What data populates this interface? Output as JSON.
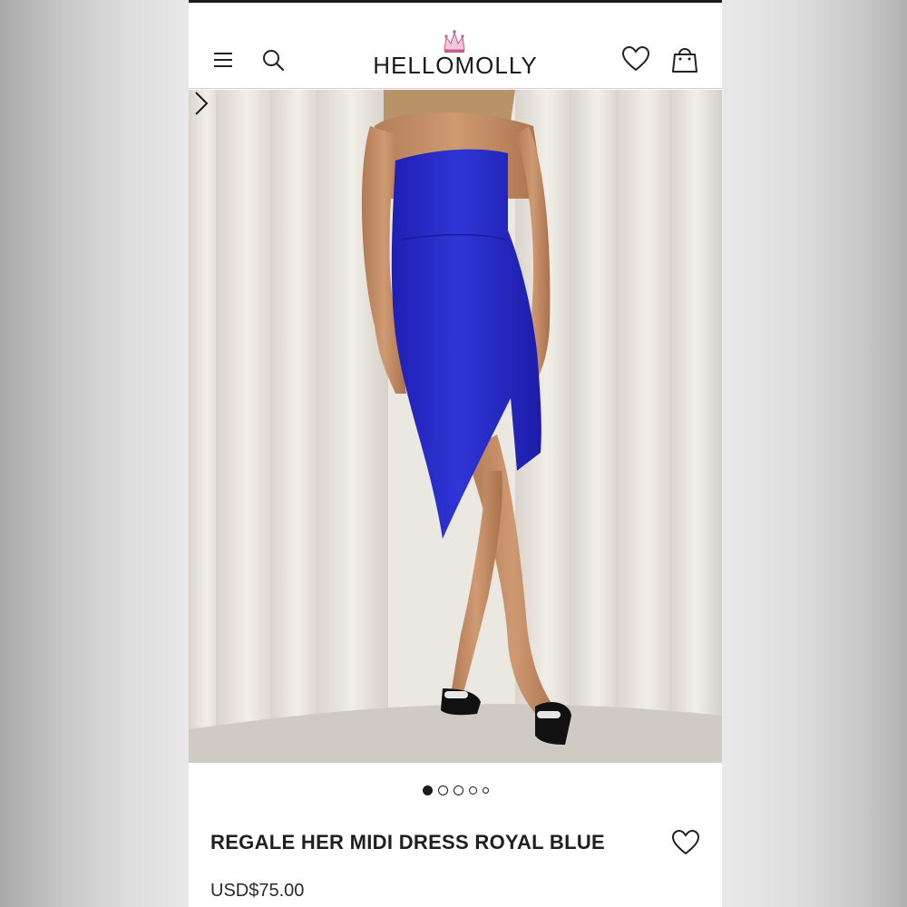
{
  "brand": {
    "name": "HELLOMOLLY",
    "crown_color": "#e8a1c3"
  },
  "header": {
    "menu_icon": "hamburger-menu-icon",
    "search_icon": "search-icon",
    "wishlist_icon": "heart-icon",
    "bag_icon": "shopping-bag-icon"
  },
  "gallery": {
    "image_description": "model wearing royal blue strapless asymmetric midi dress",
    "current_index": 1,
    "total_images": 5,
    "next_icon": "chevron-right-icon"
  },
  "product": {
    "title": "REGALE HER MIDI DRESS ROYAL BLUE",
    "price": "USD$75.00",
    "color": "#2b2fd0"
  }
}
